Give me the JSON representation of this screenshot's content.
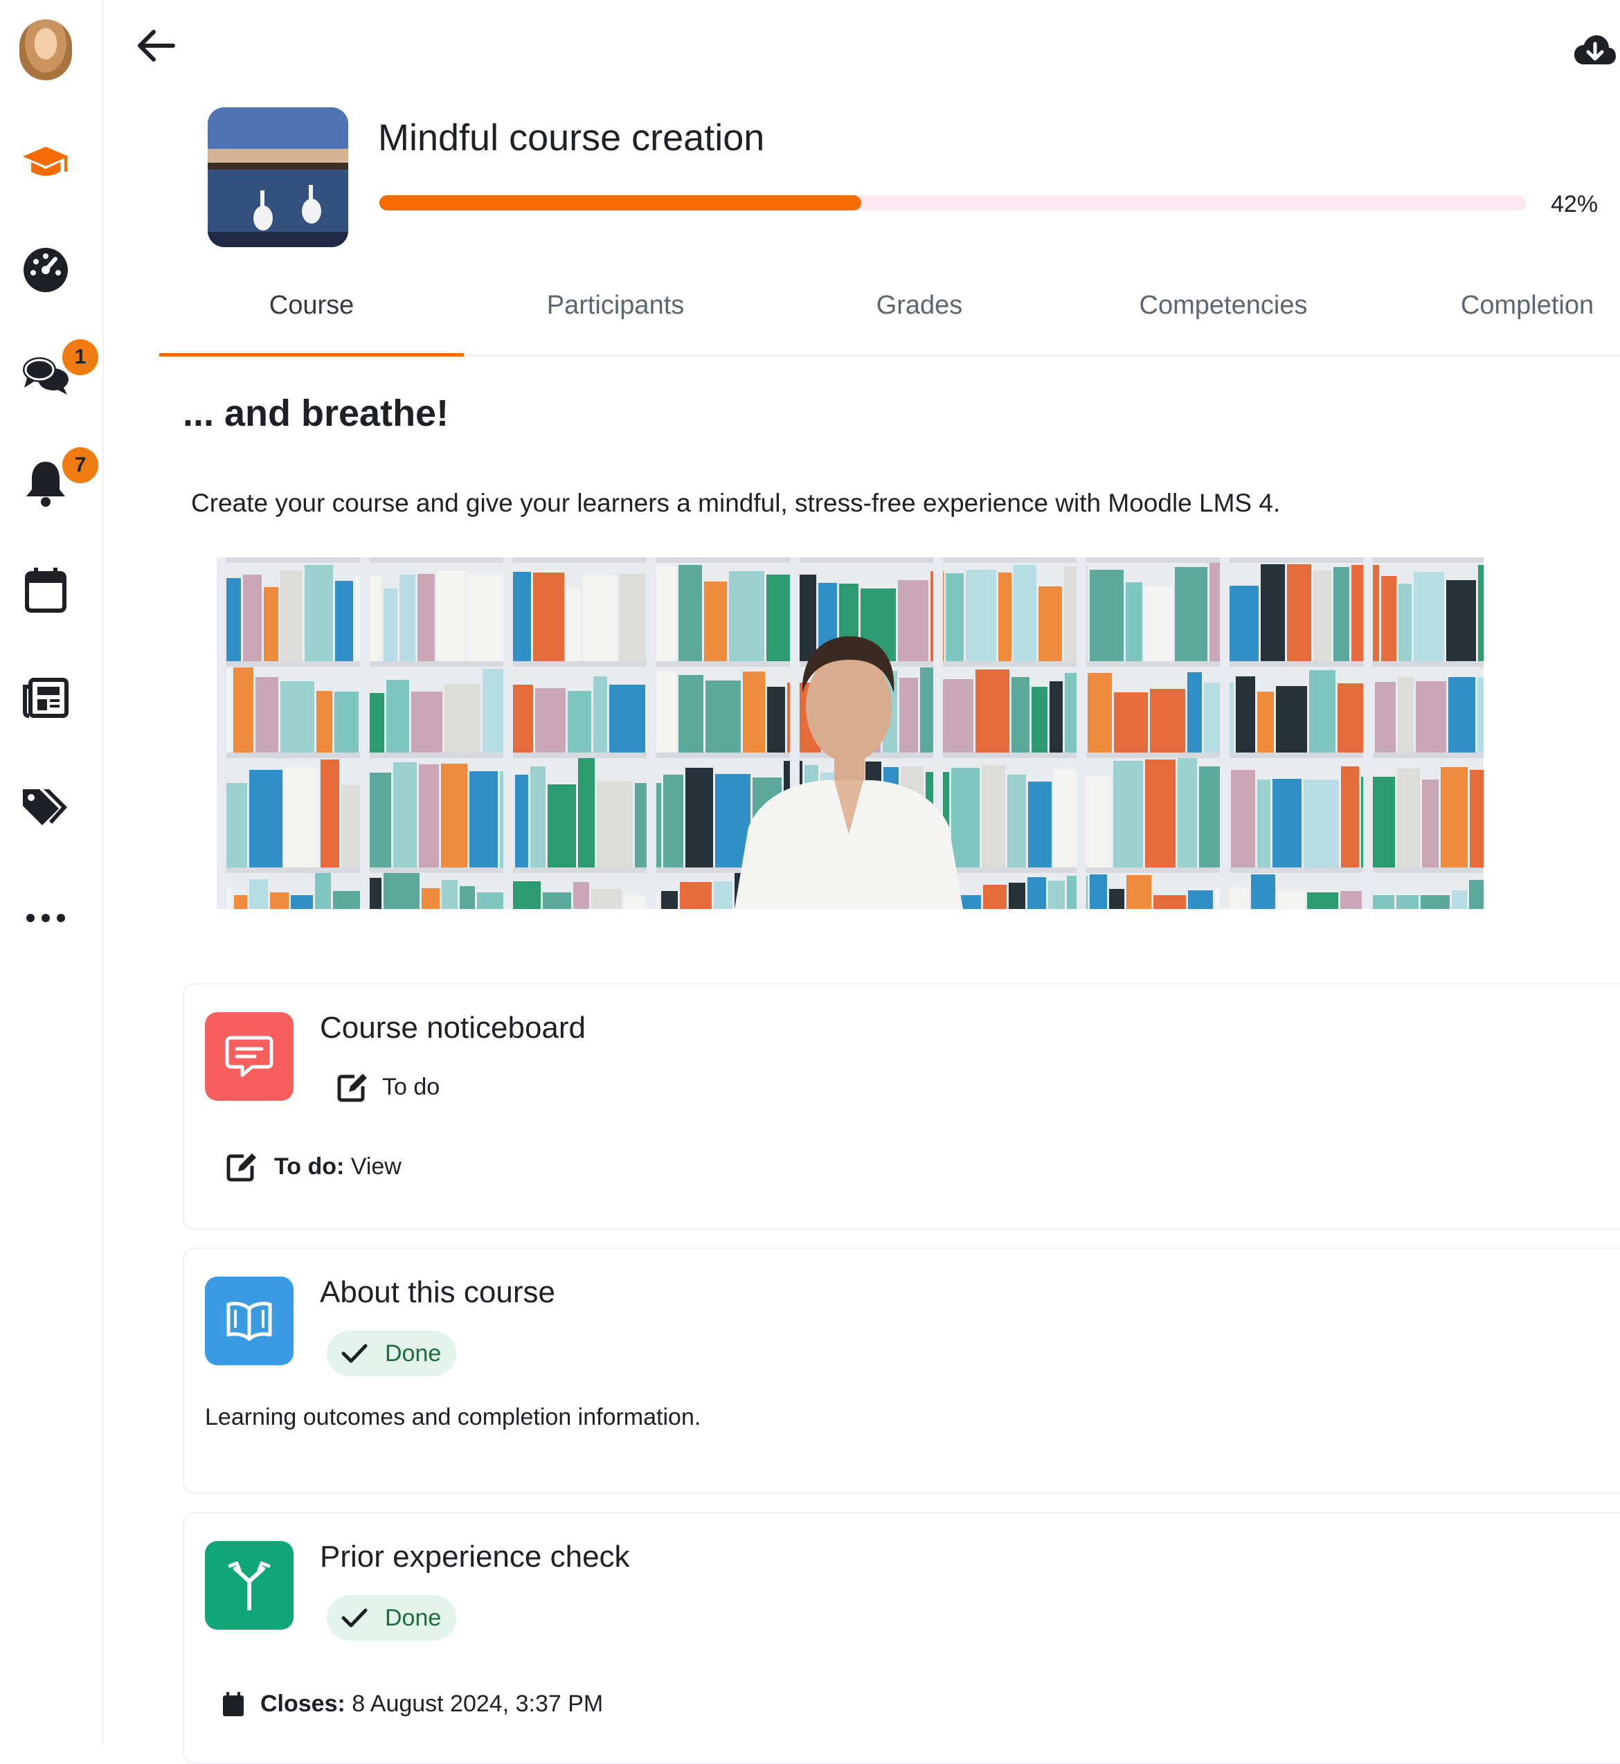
{
  "sidebar": {
    "items": [
      {
        "icon": "avatar"
      },
      {
        "icon": "graduation-cap-icon",
        "color": "#f56b00"
      },
      {
        "icon": "dashboard-gauge-icon"
      },
      {
        "icon": "messages-icon",
        "badge": "1"
      },
      {
        "icon": "bell-icon",
        "badge": "7"
      },
      {
        "icon": "calendar-icon"
      },
      {
        "icon": "newspaper-icon"
      },
      {
        "icon": "tags-icon"
      },
      {
        "icon": "more-icon"
      }
    ]
  },
  "topbar": {
    "back_icon": "arrow-left-icon",
    "download_icon": "cloud-download-icon"
  },
  "course": {
    "title": "Mindful course creation",
    "progress_percent": 42,
    "progress_label": "42%",
    "accent": "#f56b00"
  },
  "tabs": [
    "Course",
    "Participants",
    "Grades",
    "Competencies",
    "Completion"
  ],
  "intro": {
    "heading": "... and breathe!",
    "text": "Create your course and give your learners a mindful, stress-free experience with Moodle LMS 4."
  },
  "activities": [
    {
      "name": "Course noticeboard",
      "icon": "forum-icon",
      "icon_color": "#f75f5f",
      "status": "To do",
      "detail_label": "To do:",
      "detail_value": "View"
    },
    {
      "name": "About this course",
      "icon": "book-icon",
      "icon_color": "#399be2",
      "status": "Done",
      "description": "Learning outcomes and completion information."
    },
    {
      "name": "Prior experience check",
      "icon": "choice-icon",
      "icon_color": "#11a676",
      "status": "Done",
      "detail_label": "Closes:",
      "detail_value": "8 August 2024, 3:37 PM"
    }
  ]
}
